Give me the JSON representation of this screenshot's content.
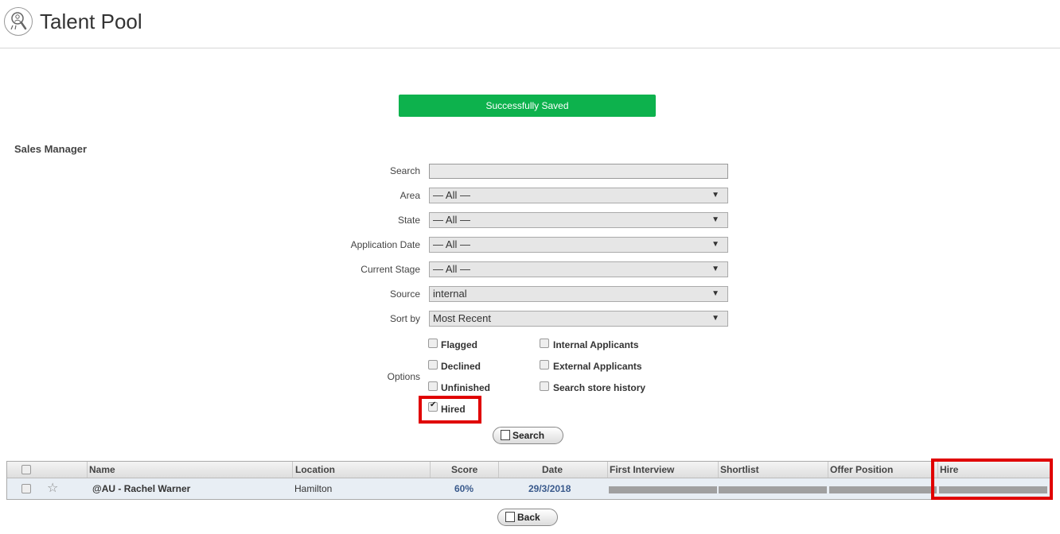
{
  "header": {
    "title": "Talent Pool",
    "icon": "talent-search-icon"
  },
  "banner": {
    "text": "Successfully Saved",
    "color": "#0db24d"
  },
  "section": {
    "title": "Sales Manager"
  },
  "form": {
    "search_label": "Search",
    "search_value": "",
    "area_label": "Area",
    "area_value": "— All —",
    "state_label": "State",
    "state_value": "— All —",
    "app_date_label": "Application Date",
    "app_date_value": "— All —",
    "stage_label": "Current Stage",
    "stage_value": "— All —",
    "source_label": "Source",
    "source_value": "internal",
    "sort_label": "Sort by",
    "sort_value": "Most Recent",
    "options_label": "Options",
    "dropdown_arrow": "▼"
  },
  "options": {
    "flagged": {
      "label": "Flagged",
      "checked": false
    },
    "declined": {
      "label": "Declined",
      "checked": false
    },
    "unfinished": {
      "label": "Unfinished",
      "checked": false
    },
    "hired": {
      "label": "Hired",
      "checked": true
    },
    "internal": {
      "label": "Internal Applicants",
      "checked": false
    },
    "external": {
      "label": "External Applicants",
      "checked": false
    },
    "store_history": {
      "label": "Search store history",
      "checked": false
    }
  },
  "buttons": {
    "search_label": "Search",
    "back_label": "Back"
  },
  "table": {
    "columns": [
      "Name",
      "Location",
      "Score",
      "Date",
      "First Interview",
      "Shortlist",
      "Offer Position",
      "Hire"
    ],
    "rows": [
      {
        "name": "@AU - Rachel Warner",
        "location": "Hamilton",
        "score": "60%",
        "date": "29/3/2018",
        "starred": false,
        "first_interview_progress": 1,
        "shortlist_progress": 1,
        "offer_position_progress": 1,
        "hire_progress": 1
      }
    ]
  },
  "highlight_color": "#e00000"
}
